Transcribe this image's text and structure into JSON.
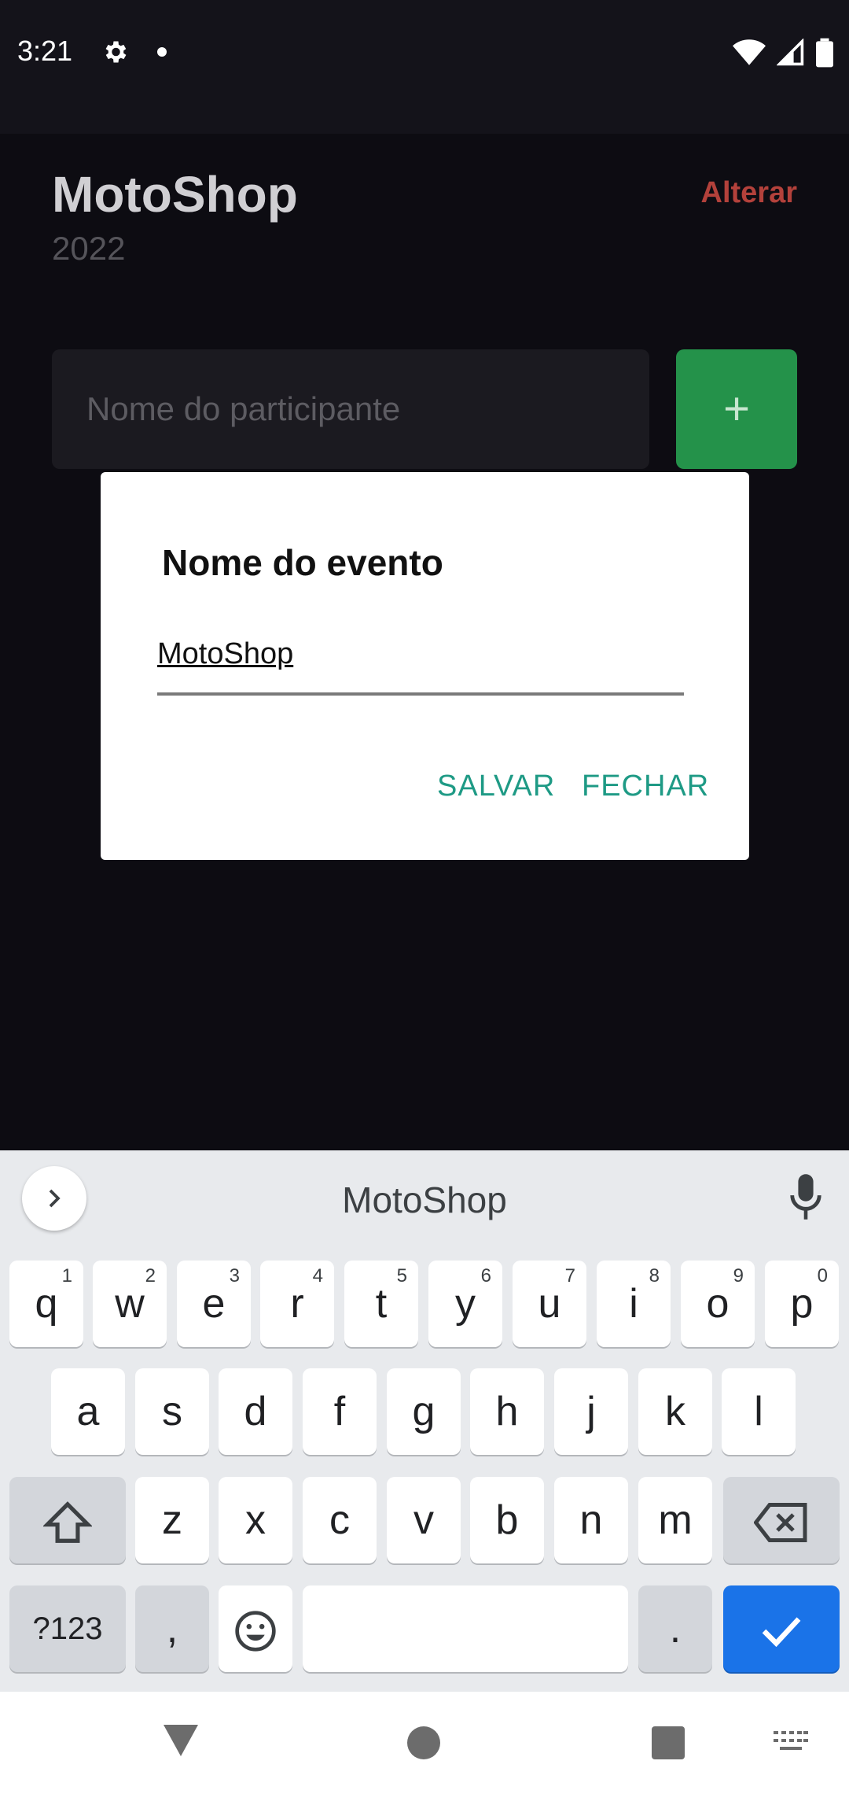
{
  "status_bar": {
    "time": "3:21"
  },
  "event": {
    "title": "MotoShop",
    "year": "2022",
    "change_label": "Alterar"
  },
  "participant": {
    "placeholder": "Nome do participante",
    "add_label": "+"
  },
  "dialog": {
    "title": "Nome do evento",
    "field_value": "MotoShop",
    "save_label": "SALVAR",
    "close_label": "FECHAR"
  },
  "keyboard": {
    "suggestion": "MotoShop",
    "row1": [
      "q",
      "w",
      "e",
      "r",
      "t",
      "y",
      "u",
      "i",
      "o",
      "p"
    ],
    "row1_hints": [
      "1",
      "2",
      "3",
      "4",
      "5",
      "6",
      "7",
      "8",
      "9",
      "0"
    ],
    "row2": [
      "a",
      "s",
      "d",
      "f",
      "g",
      "h",
      "j",
      "k",
      "l"
    ],
    "row3": [
      "z",
      "x",
      "c",
      "v",
      "b",
      "n",
      "m"
    ],
    "symbols_label": "?123",
    "comma_label": ",",
    "period_label": "."
  },
  "colors": {
    "accent_green": "#24924a",
    "link_red": "#b3413b",
    "dialog_button": "#1e9a85",
    "enter_blue": "#1a73e8"
  }
}
